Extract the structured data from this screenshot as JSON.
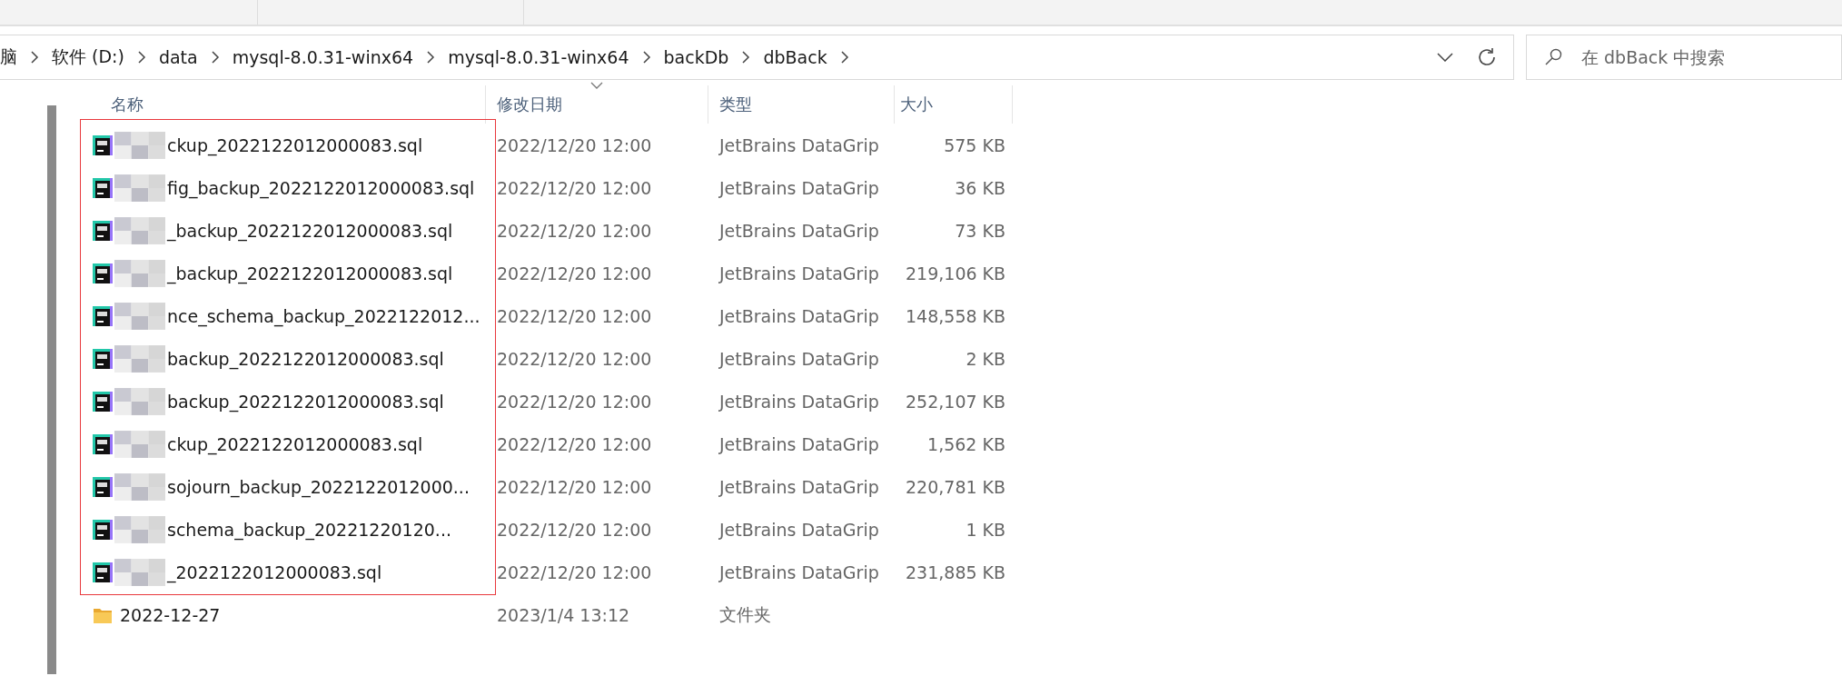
{
  "breadcrumb": [
    "脑",
    "软件 (D:)",
    "data",
    "mysql-8.0.31-winx64",
    "mysql-8.0.31-winx64",
    "backDb",
    "dbBack"
  ],
  "search": {
    "placeholder": "在 dbBack 中搜索"
  },
  "columns": [
    {
      "label": "名称",
      "sorted": false
    },
    {
      "label": "修改日期",
      "sorted": true
    },
    {
      "label": "类型",
      "sorted": false
    },
    {
      "label": "大小",
      "sorted": false
    }
  ],
  "rows": [
    {
      "kind": "file",
      "name": "ckup_2022122012000083.sql",
      "modified": "2022/12/20 12:00",
      "type": "JetBrains DataGrip",
      "size": "575 KB"
    },
    {
      "kind": "file",
      "name": "fig_backup_2022122012000083.sql",
      "modified": "2022/12/20 12:00",
      "type": "JetBrains DataGrip",
      "size": "36 KB"
    },
    {
      "kind": "file",
      "name": "_backup_2022122012000083.sql",
      "modified": "2022/12/20 12:00",
      "type": "JetBrains DataGrip",
      "size": "73 KB"
    },
    {
      "kind": "file",
      "name": "_backup_2022122012000083.sql",
      "modified": "2022/12/20 12:00",
      "type": "JetBrains DataGrip",
      "size": "219,106 KB"
    },
    {
      "kind": "file",
      "name": "nce_schema_backup_2022122012...",
      "modified": "2022/12/20 12:00",
      "type": "JetBrains DataGrip",
      "size": "148,558 KB"
    },
    {
      "kind": "file",
      "name": "backup_2022122012000083.sql",
      "modified": "2022/12/20 12:00",
      "type": "JetBrains DataGrip",
      "size": "2 KB"
    },
    {
      "kind": "file",
      "name": "backup_2022122012000083.sql",
      "modified": "2022/12/20 12:00",
      "type": "JetBrains DataGrip",
      "size": "252,107 KB"
    },
    {
      "kind": "file",
      "name": "ckup_2022122012000083.sql",
      "modified": "2022/12/20 12:00",
      "type": "JetBrains DataGrip",
      "size": "1,562 KB"
    },
    {
      "kind": "file",
      "name": "sojourn_backup_2022122012000...",
      "modified": "2022/12/20 12:00",
      "type": "JetBrains DataGrip",
      "size": "220,781 KB"
    },
    {
      "kind": "file",
      "name": "schema_backup_20221220120...",
      "modified": "2022/12/20 12:00",
      "type": "JetBrains DataGrip",
      "size": "1 KB"
    },
    {
      "kind": "file",
      "name": "_2022122012000083.sql",
      "modified": "2022/12/20 12:00",
      "type": "JetBrains DataGrip",
      "size": "231,885 KB"
    },
    {
      "kind": "folder",
      "name": "2022-12-27",
      "modified": "2023/1/4 13:12",
      "type": "文件夹"
    }
  ],
  "highlight_frame": {
    "color": "#e8383d"
  }
}
